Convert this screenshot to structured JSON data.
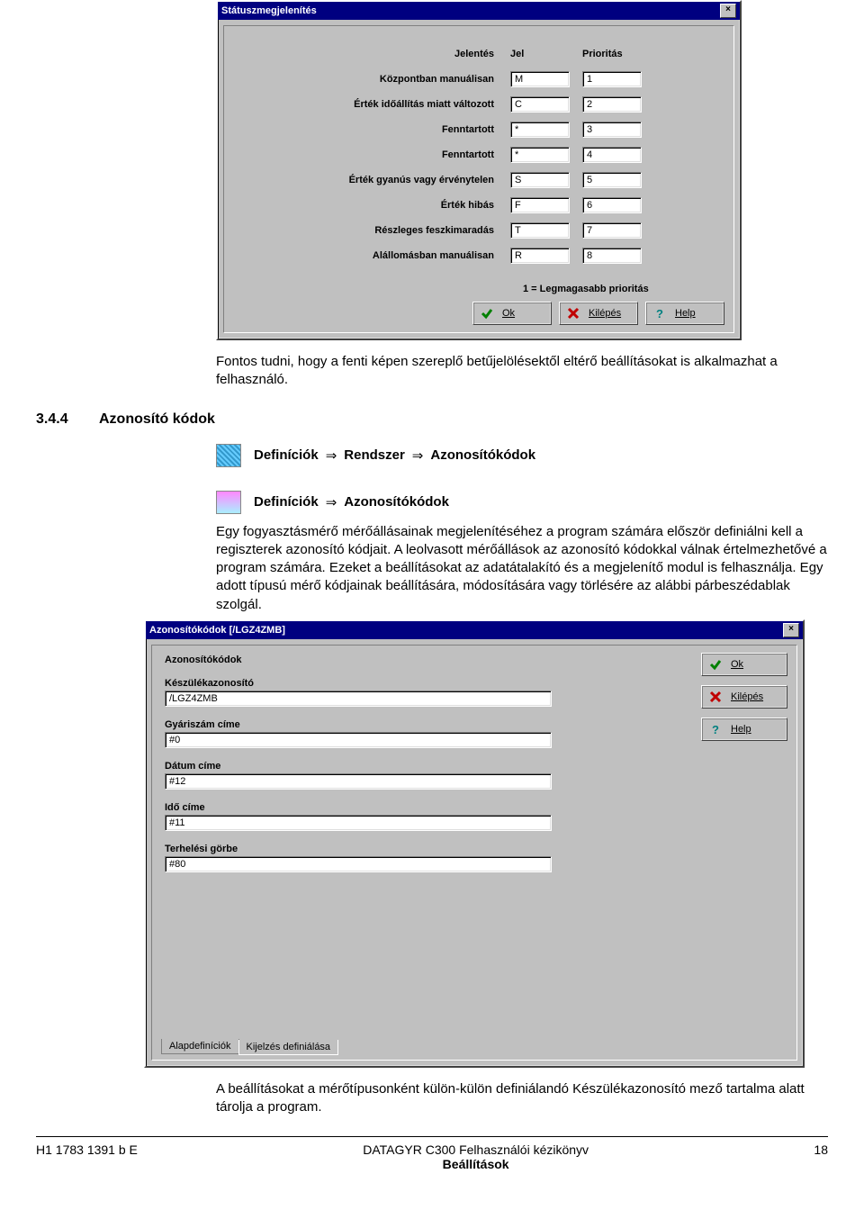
{
  "dialog1": {
    "title": "Státuszmegjelenítés",
    "headers": {
      "jelentes": "Jelentés",
      "jel": "Jel",
      "prioritas": "Prioritás"
    },
    "rows": [
      {
        "label": "Központban manuálisan",
        "jel": "M",
        "pri": "1"
      },
      {
        "label": "Érték időállítás miatt változott",
        "jel": "C",
        "pri": "2"
      },
      {
        "label": "Fenntartott",
        "jel": "*",
        "pri": "3"
      },
      {
        "label": "Fenntartott",
        "jel": "*",
        "pri": "4"
      },
      {
        "label": "Érték gyanús vagy érvénytelen",
        "jel": "S",
        "pri": "5"
      },
      {
        "label": "Érték hibás",
        "jel": "F",
        "pri": "6"
      },
      {
        "label": "Részleges feszkimaradás",
        "jel": "T",
        "pri": "7"
      },
      {
        "label": "Alállomásban manuálisan",
        "jel": "R",
        "pri": "8"
      }
    ],
    "note": "1 = Legmagasabb prioritás",
    "buttons": {
      "ok": "Ok",
      "kilepes": "Kilépés",
      "help": "Help"
    }
  },
  "text": {
    "after_d1": "Fontos tudni, hogy a fenti képen szereplő betűjelölésektől eltérő beállításokat is alkalmazhat a felhasználó.",
    "section_no": "3.4.4",
    "section_title": "Azonosító kódok",
    "def1_a": "Definíciók",
    "def1_b": "Rendszer",
    "def1_c": "Azonosítókódok",
    "def2_a": "Definíciók",
    "def2_b": "Azonosítókódok",
    "para": "Egy fogyasztásmérő mérőállásainak megjelenítéséhez a program számára először definiálni kell a regiszterek azonosító kódjait. A leolvasott mérőállások az azonosító kódokkal válnak értelmezhetővé a program számára. Ezeket a beállításokat az adatátalakító és a megjelenítő modul is felhasználja. Egy adott típusú mérő kódjainak beállítására, módosítására vagy törlésére az alábbi párbeszédablak szolgál."
  },
  "dialog2": {
    "title": "Azonosítókódok [/LGZ4ZMB]",
    "group": "Azonosítókódok",
    "fields": {
      "keszulek_label": "Készülékazonosító",
      "keszulek_val": "/LGZ4ZMB",
      "gyari_label": "Gyáriszám címe",
      "gyari_val": "#0",
      "datum_label": "Dátum címe",
      "datum_val": "#12",
      "ido_label": "Idő címe",
      "ido_val": "#11",
      "terh_label": "Terhelési görbe",
      "terh_val": "#80"
    },
    "buttons": {
      "ok": "Ok",
      "kilepes": "Kilépés",
      "help": "Help"
    },
    "tabs": {
      "t1": "Alapdefiníciók",
      "t2": "Kijelzés definiálása"
    }
  },
  "after_d2": "A beállításokat a mérőtípusonként külön-külön definiálandó Készülékazonosító mező tartalma alatt tárolja a program.",
  "footer": {
    "left": "H1 1783 1391 b E",
    "center1": "DATAGYR C300 Felhasználói kézikönyv",
    "center2": "Beállítások",
    "right": "18"
  }
}
